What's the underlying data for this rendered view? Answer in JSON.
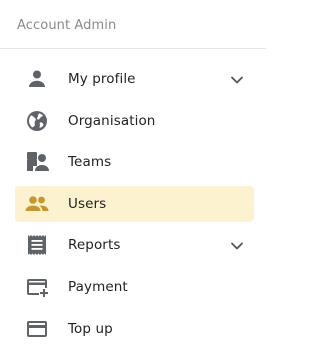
{
  "sidebar": {
    "section_title": "Account Admin",
    "items": [
      {
        "label": "My profile",
        "icon": "person-icon",
        "has_chevron": true,
        "active": false
      },
      {
        "label": "Organisation",
        "icon": "globe-icon",
        "has_chevron": false,
        "active": false
      },
      {
        "label": "Teams",
        "icon": "teams-icon",
        "has_chevron": false,
        "active": false
      },
      {
        "label": "Users",
        "icon": "users-icon",
        "has_chevron": false,
        "active": true
      },
      {
        "label": "Reports",
        "icon": "receipt-icon",
        "has_chevron": true,
        "active": false
      },
      {
        "label": "Payment",
        "icon": "add-card-icon",
        "has_chevron": false,
        "active": false
      },
      {
        "label": "Top up",
        "icon": "credit-card-icon",
        "has_chevron": false,
        "active": false
      }
    ]
  },
  "colors": {
    "icon_default": "#5f6368",
    "icon_active": "#c8962e",
    "active_background": "#fdf2cf",
    "section_title": "#8a8a8a"
  }
}
